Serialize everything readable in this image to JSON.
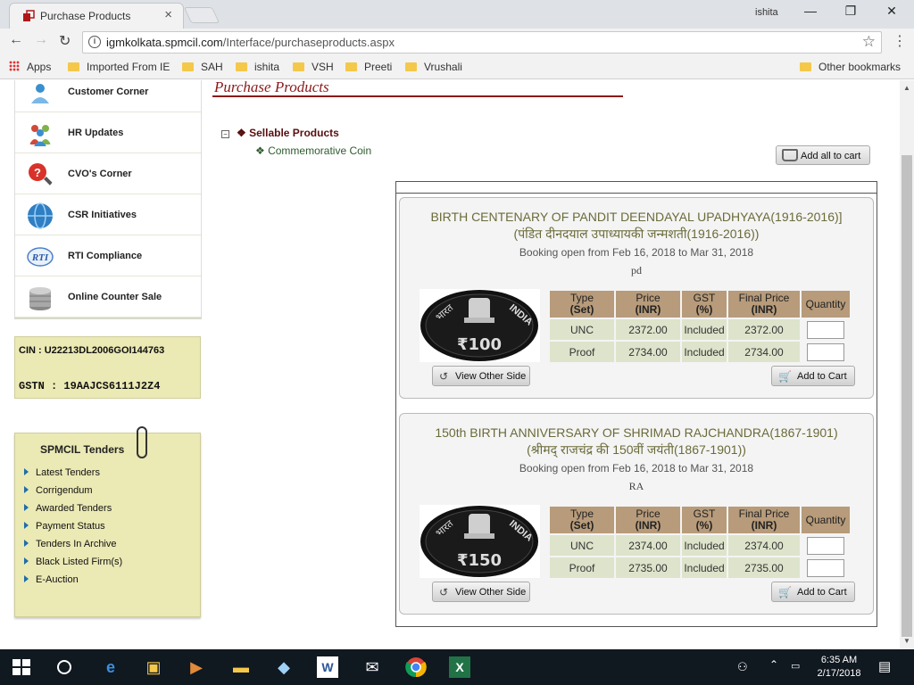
{
  "browser": {
    "tab_title": "Purchase Products",
    "tab_close": "×",
    "profile_name": "ishita",
    "window_controls": {
      "minimize": "—",
      "maximize": "❐",
      "close": "✕"
    },
    "nav": {
      "back": "←",
      "forward": "→",
      "reload": "↻",
      "menu": "⋮",
      "star": "☆"
    },
    "url_host": "igmkolkata.spmcil.com",
    "url_path": "/Interface/purchaseproducts.aspx",
    "bookmarks": {
      "apps": "Apps",
      "items": [
        "Imported From IE",
        "SAH",
        "ishita",
        "VSH",
        "Preeti",
        "Vrushali"
      ],
      "other": "Other bookmarks"
    }
  },
  "sidebar": {
    "items": [
      {
        "label": "Customer Corner",
        "icon": "customer-icon",
        "color": "#3a8fd0"
      },
      {
        "label": "HR Updates",
        "icon": "people-icon",
        "color": "#7fb24a"
      },
      {
        "label": "CVO's Corner",
        "icon": "magnifier-icon",
        "color": "#d8322a"
      },
      {
        "label": "CSR Initiatives",
        "icon": "globe-icon",
        "color": "#2f7fc4"
      },
      {
        "label": "RTI Compliance",
        "icon": "rti-icon",
        "color": "#4a80c8"
      },
      {
        "label": "Online Counter Sale",
        "icon": "coins-icon",
        "color": "#9a9a9a"
      }
    ],
    "cin": "CIN : U22213DL2006GOI144763",
    "gstn": "GSTN : 19AAJCS6111J2Z4",
    "tenders": {
      "heading": "SPMCIL Tenders",
      "items": [
        "Latest Tenders",
        "Corrigendum",
        "Awarded Tenders",
        "Payment Status",
        "Tenders In Archive",
        "Black Listed Firm(s)",
        "E-Auction"
      ]
    }
  },
  "main": {
    "title": "Purchase Products",
    "tree_toggle": "⊟",
    "tree_root": "❖ Sellable Products",
    "tree_child": "❖ Commemorative Coin",
    "add_all": "Add all to cart",
    "table_headers": {
      "type": "Type",
      "type_sub": "(Set)",
      "price": "Price",
      "price_sub": "(INR)",
      "gst": "GST",
      "gst_sub": "(%)",
      "final": "Final Price",
      "final_sub": "(INR)",
      "qty": "Quantity"
    },
    "view_other_side": "View Other Side",
    "add_to_cart": "Add to Cart",
    "products": [
      {
        "name_en": "BIRTH CENTENARY OF PANDIT DEENDAYAL UPADHYAYA(1916-2016)]",
        "name_hi": "(पंडित दीनदयाल उपाध्यायकी जन्मशती(1916-2016))",
        "booking": "Booking open from Feb 16, 2018 to Mar 31, 2018",
        "code": "pd",
        "coin_value": "₹100",
        "coin_text_left": "भारत",
        "coin_text_right": "INDIA",
        "rows": [
          {
            "type": "UNC",
            "price": "2372.00",
            "gst": "Included",
            "final": "2372.00"
          },
          {
            "type": "Proof",
            "price": "2734.00",
            "gst": "Included",
            "final": "2734.00"
          }
        ]
      },
      {
        "name_en": "150th BIRTH ANNIVERSARY OF SHRIMAD RAJCHANDRA(1867-1901)",
        "name_hi": "(श्रीमद् राजचंद्र की 150वीं जयंती(1867-1901))",
        "booking": "Booking open from Feb 16, 2018 to Mar 31, 2018",
        "code": "RA",
        "coin_value": "₹150",
        "coin_text_left": "भारत",
        "coin_text_right": "INDIA",
        "rows": [
          {
            "type": "UNC",
            "price": "2374.00",
            "gst": "Included",
            "final": "2374.00"
          },
          {
            "type": "Proof",
            "price": "2735.00",
            "gst": "Included",
            "final": "2735.00"
          }
        ]
      }
    ]
  },
  "taskbar": {
    "time": "6:35 AM",
    "date": "2/17/2018"
  }
}
